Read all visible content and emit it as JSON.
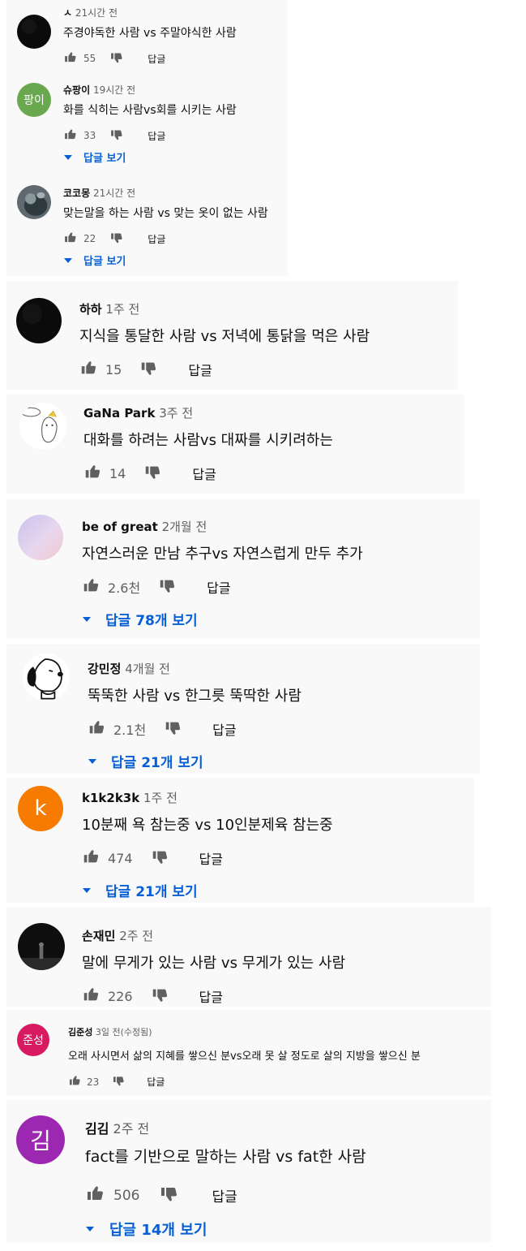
{
  "colors": {
    "link": "#065fd4",
    "meta": "#606060",
    "card": "#f9f9f9"
  },
  "comments": [
    {
      "author": "ㅅ",
      "time": "21시간 전",
      "text": "주경야독한 사람 vs 주말야식한 사람",
      "likes": "55",
      "reply": "답글",
      "avatar": {
        "kind": "dark",
        "label": ""
      }
    },
    {
      "author": "슈팡이",
      "time": "19시간 전",
      "text": "화를 식히는 사람vs회를 시키는 사람",
      "likes": "33",
      "reply": "답글",
      "replies": "답글 보기",
      "avatar": {
        "kind": "letter",
        "label": "팡이",
        "color": "#6aa84f"
      }
    },
    {
      "author": "코코몽",
      "time": "21시간 전",
      "text": "맞는말을 하는 사람 vs 맞는 옷이 없는 사람",
      "likes": "22",
      "reply": "답글",
      "replies": "답글 보기",
      "avatar": {
        "kind": "photo",
        "label": ""
      }
    },
    {
      "author": "하하",
      "time": "1주 전",
      "text": "지식을 통달한 사람 vs 저녁에 통닭을 먹은 사람",
      "likes": "15",
      "reply": "답글",
      "avatar": {
        "kind": "dark",
        "label": ""
      }
    },
    {
      "author": "GaNa Park",
      "time": "3주 전",
      "text": "대화를 하려는 사람vs 대짜를 시키려하는",
      "likes": "14",
      "reply": "답글",
      "avatar": {
        "kind": "drawing",
        "label": ""
      }
    },
    {
      "author": "be of great",
      "time": "2개월 전",
      "text": "자연스러운 만남 추구vs 자연스럽게 만두 추가",
      "likes": "2.6천",
      "reply": "답글",
      "replies": "답글 78개 보기",
      "avatar": {
        "kind": "gradient",
        "label": ""
      }
    },
    {
      "author": "강민정",
      "time": "4개월 전",
      "text": "뚝뚝한 사람 vs 한그릇 뚝딱한 사람",
      "likes": "2.1천",
      "reply": "답글",
      "replies": "답글 21개 보기",
      "avatar": {
        "kind": "snoopy",
        "label": ""
      }
    },
    {
      "author": "k1k2k3k",
      "time": "1주 전",
      "text": "10분째 욕 참는중 vs 10인분제육 참는중",
      "likes": "474",
      "reply": "답글",
      "replies": "답글 21개 보기",
      "avatar": {
        "kind": "letter",
        "label": "k",
        "color": "#f57c00"
      }
    },
    {
      "author": "손재민",
      "time": "2주 전",
      "text": "말에 무게가 있는 사람 vs 무게가 있는 사람",
      "likes": "226",
      "reply": "답글",
      "avatar": {
        "kind": "night",
        "label": ""
      }
    },
    {
      "author": "김준성",
      "time": "3일 전(수정됨)",
      "text": "오래 사시면서 삶의 지혜를 쌓으신 분vs오래 못 살 정도로 살의 지방을 쌓으신 분",
      "likes": "23",
      "reply": "답글",
      "avatar": {
        "kind": "letter",
        "label": "준성",
        "color": "#d81b60"
      }
    },
    {
      "author": "김김",
      "time": "2주 전",
      "text": "fact를 기반으로 말하는 사람 vs fat한 사람",
      "likes": "506",
      "reply": "답글",
      "replies": "답글 14개 보기",
      "avatar": {
        "kind": "letter",
        "label": "김",
        "color": "#9c27b0"
      }
    }
  ]
}
